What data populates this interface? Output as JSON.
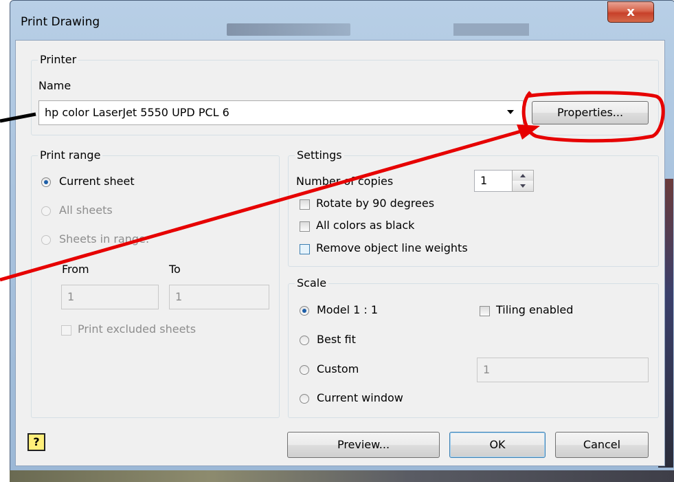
{
  "window": {
    "title": "Print Drawing",
    "close_label": "x"
  },
  "printer": {
    "group_label": "Printer",
    "name_label": "Name",
    "selected_printer": "hp color LaserJet 5550  UPD PCL 6",
    "properties_button": "Properties..."
  },
  "print_range": {
    "group_label": "Print range",
    "options": [
      {
        "label": "Current sheet",
        "selected": true,
        "enabled": true
      },
      {
        "label": "All sheets",
        "selected": false,
        "enabled": false
      },
      {
        "label": "Sheets in range:",
        "selected": false,
        "enabled": false
      }
    ],
    "from_label": "From",
    "to_label": "To",
    "from_value": "1",
    "to_value": "1",
    "print_excluded_label": "Print excluded sheets"
  },
  "settings": {
    "group_label": "Settings",
    "copies_label": "Number of copies",
    "copies_value": "1",
    "rotate_label": "Rotate by 90 degrees",
    "all_black_label": "All colors as black",
    "remove_weights_label": "Remove object line weights"
  },
  "scale": {
    "group_label": "Scale",
    "options": [
      {
        "label": "Model 1 : 1",
        "selected": true
      },
      {
        "label": "Best fit",
        "selected": false
      },
      {
        "label": "Custom",
        "selected": false
      },
      {
        "label": "Current window",
        "selected": false
      }
    ],
    "tiling_label": "Tiling enabled",
    "custom_value": "1"
  },
  "footer": {
    "help_label": "?",
    "preview_button": "Preview...",
    "ok_button": "OK",
    "cancel_button": "Cancel"
  },
  "colors": {
    "annotation_red": "#e60000",
    "selected_radio": "#1e5fa8"
  }
}
